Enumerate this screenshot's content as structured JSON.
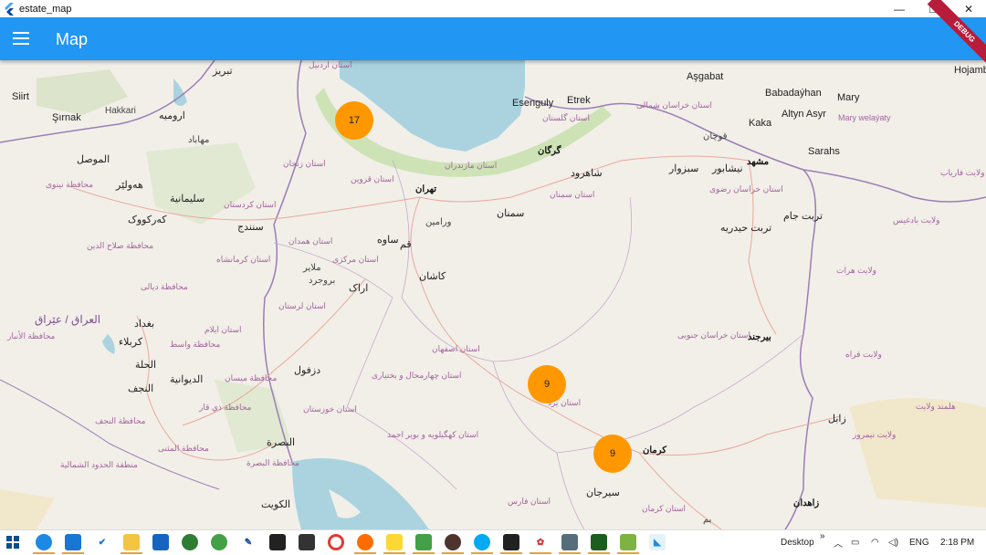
{
  "window": {
    "title": "estate_map",
    "controls": {
      "minimize": "—",
      "maximize": "❐",
      "close": "✕"
    }
  },
  "appbar": {
    "title": "Map",
    "debug_banner": "DEBUG"
  },
  "map": {
    "clusters": [
      {
        "count": "17"
      },
      {
        "count": "9"
      },
      {
        "count": "9"
      }
    ],
    "cities": {
      "tehran": "تهران",
      "qom": "قم",
      "kashan": "کاشان",
      "arak": "اراک",
      "semnan": "سمنان",
      "gorgan": "گرگان",
      "mashhad": "مشهد",
      "kerman": "کرمان",
      "zahedan": "زاهدان",
      "birjand": "بیرجند",
      "sirjan": "سیرجان",
      "sanandaj": "سنندج",
      "tabriz": "تبریز",
      "urmia": "ارومیه",
      "baghdad": "بغداد",
      "basra": "البصرة",
      "kuwait": "الكويت",
      "sulaymaniyah": "سليمانية",
      "erbil": "هەولێر",
      "kirkuk": "کەرکووک",
      "mosul": "الموصل",
      "karbala": "كربلاء",
      "najaf": "النجف",
      "hillah": "الحلة",
      "diwaniyah": "الديوانية",
      "zabol": "زابل",
      "dezful": "دزفول",
      "siirt": "Siirt",
      "sirnak": "Şırnak",
      "hakkari": "Hakkari",
      "esenguly": "Esenguly",
      "etrek": "Etrek",
      "asgabat": "Aşgabat",
      "babadayhan": "Babadaýhan",
      "mary": "Mary",
      "altyn_asyr": "Altyn Asyr",
      "kaka": "Kaka",
      "sarahs": "Sarahs",
      "hojamb": "Hojamb",
      "shahrud": "شاهرود",
      "quchan": "قوچان",
      "sabzevar": "سبزوار",
      "neyshabur": "نیشابور",
      "torbat_jam": "تربت جام",
      "torbat_heydarieh": "تربت حیدریه",
      "varamin": "ورامین",
      "saveh": "ساوه",
      "borujerd": "بروجرد",
      "malayer": "ملایر",
      "bam": "بم",
      "mahabad": "مهاباد"
    },
    "provinces": {
      "tehran_prov": "استان تهران",
      "semnan_prov": "استان سمنان",
      "golestan": "استان گلستان",
      "mazandaran": "استان مازندران",
      "north_khorasan": "استان خراسان شمالی",
      "razavi": "استان خراسان رضوی",
      "south_khorasan": "استان خراسان جنوبی",
      "zanjan": "استان زنجان",
      "qazvin": "استان قزوین",
      "kurdistan": "استان کردستان",
      "hamadan": "استان همدان",
      "markazi": "استان مرکزی",
      "kermanshah": "استان کرمانشاه",
      "lorestan": "استان لرستان",
      "ilam": "استان ایلام",
      "isfahan": "استان اصفهان",
      "chaharmahal": "استان چهارمحال و بختیاری",
      "khuzestan": "استان خوزستان",
      "kohgiluyeh": "استان کهگیلویه و بویر احمد",
      "fars": "استان فارس",
      "kerman_prov": "استان کرمان",
      "yazd": "استان یزد",
      "ardabil": "استان اردبیل",
      "mary_welayaty": "Mary welaýaty",
      "iraq": "العراق / عێراق",
      "anbar": "محافظة الأنبار",
      "wasit": "محافظة واسط",
      "muthanna": "محافظة المثنى",
      "najaf_gov": "محافظة النجف",
      "basra_gov": "محافظة البصرة",
      "diyala": "محافظة ديالى",
      "nineveh": "محافظة نينوى",
      "salahuddin": "محافظة صلاح الدين",
      "maysan": "محافظة ميسان",
      "dhi_qar": "محافظة ذي قار",
      "herat": "ولایت هرات",
      "farah": "ولایت فراه",
      "badghis": "ولایت بادغیس",
      "nimruz": "ولایت نیمروز",
      "helmand": "هلمند ولایت",
      "faryab": "ولایت فاریاب",
      "northern_border": "منطقة الحدود الشمالية"
    }
  },
  "taskbar": {
    "apps": [
      "Windows",
      "Edge",
      "VS Code",
      "Tasks",
      "Files",
      "Calendar",
      "Xbox",
      "Telegram",
      "Tool",
      "Sticky",
      "Android",
      "Chrome",
      "Postman",
      "Notes",
      "Camtasia",
      "Music",
      "Skype",
      "Terminal",
      "Paint",
      "Calculator",
      "Excel",
      "Android Studio",
      "Flutter"
    ],
    "desktop_label": "Desktop",
    "chevron": "»",
    "lang": "ENG",
    "time": "2:18 PM"
  }
}
